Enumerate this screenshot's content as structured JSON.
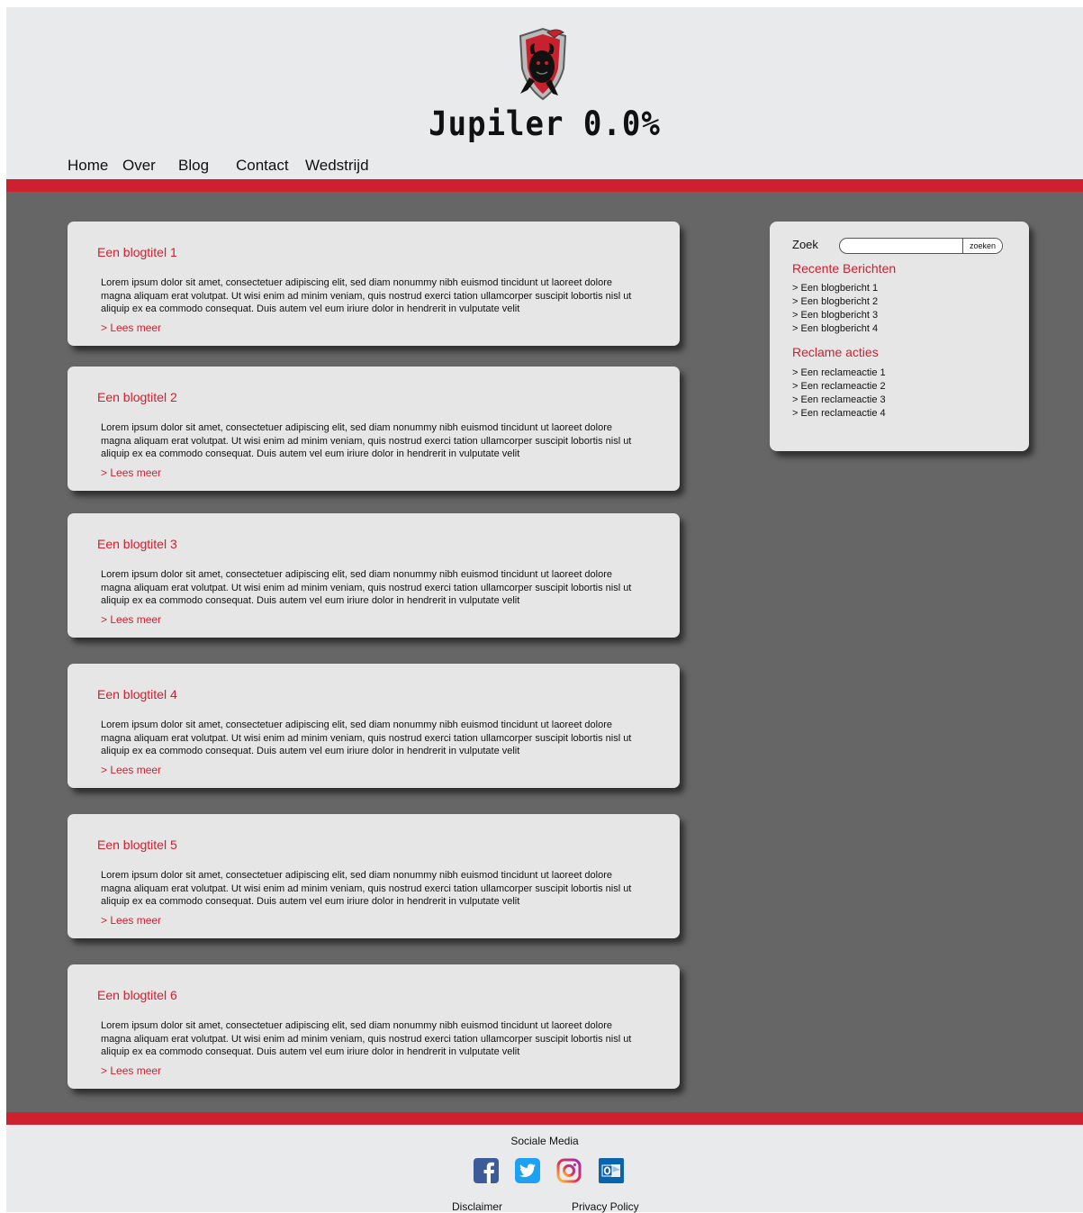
{
  "brand": {
    "name": "Jupiler 0.0%"
  },
  "nav": {
    "items": [
      "Home",
      "Over",
      "Blog",
      "Contact",
      "Wedstrijd"
    ]
  },
  "posts": [
    {
      "title": "Een blogtitel 1",
      "body": "Lorem ipsum dolor sit amet, consectetuer adipiscing elit, sed diam nonummy nibh euismod tincidunt ut laoreet dolore magna aliquam erat volutpat. Ut wisi enim ad minim veniam, quis nostrud exerci tation ullamcorper suscipit lobortis nisl ut aliquip ex ea commodo consequat. Duis autem vel eum iriure dolor in hendrerit in vulputate velit",
      "more": "> Lees meer"
    },
    {
      "title": "Een blogtitel 2",
      "body": "Lorem ipsum dolor sit amet, consectetuer adipiscing elit, sed diam nonummy nibh euismod tincidunt ut laoreet dolore magna aliquam erat volutpat. Ut wisi enim ad minim veniam, quis nostrud exerci tation ullamcorper suscipit lobortis nisl ut aliquip ex ea commodo consequat. Duis autem vel eum iriure dolor in hendrerit in vulputate velit",
      "more": "> Lees meer"
    },
    {
      "title": "Een blogtitel 3",
      "body": "Lorem ipsum dolor sit amet, consectetuer adipiscing elit, sed diam nonummy nibh euismod tincidunt ut laoreet dolore magna aliquam erat volutpat. Ut wisi enim ad minim veniam, quis nostrud exerci tation ullamcorper suscipit lobortis nisl ut aliquip ex ea commodo consequat. Duis autem vel eum iriure dolor in hendrerit in vulputate velit",
      "more": "> Lees meer"
    },
    {
      "title": "Een blogtitel 4",
      "body": "Lorem ipsum dolor sit amet, consectetuer adipiscing elit, sed diam nonummy nibh euismod tincidunt ut laoreet dolore magna aliquam erat volutpat. Ut wisi enim ad minim veniam, quis nostrud exerci tation ullamcorper suscipit lobortis nisl ut aliquip ex ea commodo consequat. Duis autem vel eum iriure dolor in hendrerit in vulputate velit",
      "more": "> Lees meer"
    },
    {
      "title": "Een blogtitel 5",
      "body": "Lorem ipsum dolor sit amet, consectetuer adipiscing elit, sed diam nonummy nibh euismod tincidunt ut laoreet dolore magna aliquam erat volutpat. Ut wisi enim ad minim veniam, quis nostrud exerci tation ullamcorper suscipit lobortis nisl ut aliquip ex ea commodo consequat. Duis autem vel eum iriure dolor in hendrerit in vulputate velit",
      "more": "> Lees meer"
    },
    {
      "title": "Een blogtitel 6",
      "body": "Lorem ipsum dolor sit amet, consectetuer adipiscing elit, sed diam nonummy nibh euismod tincidunt ut laoreet dolore magna aliquam erat volutpat. Ut wisi enim ad minim veniam, quis nostrud exerci tation ullamcorper suscipit lobortis nisl ut aliquip ex ea commodo consequat. Duis autem vel eum iriure dolor in hendrerit in vulputate velit",
      "more": "> Lees meer"
    }
  ],
  "sidebar": {
    "search_label": "Zoek",
    "search_placeholder": "",
    "search_button": "zoeken",
    "recent_heading": "Recente Berichten",
    "recent_items": [
      "> Een blogbericht 1",
      "> Een blogbericht 2",
      "> Een blogbericht 3",
      "> Een blogbericht 4"
    ],
    "promo_heading": "Reclame acties",
    "promo_items": [
      "> Een reclameactie 1",
      "> Een reclameactie 2",
      "> Een reclameactie 3",
      "> Een reclameactie 4"
    ]
  },
  "footer": {
    "social_title": "Sociale Media",
    "social_icons": [
      "facebook-icon",
      "twitter-icon",
      "instagram-icon",
      "outlook-icon"
    ],
    "disclaimer": "Disclaimer",
    "privacy": "Privacy Policy"
  },
  "colors": {
    "accent": "#cf2030",
    "page_background": "#e9eaec",
    "content_background": "#666666",
    "card_background": "#e6e6e6"
  }
}
